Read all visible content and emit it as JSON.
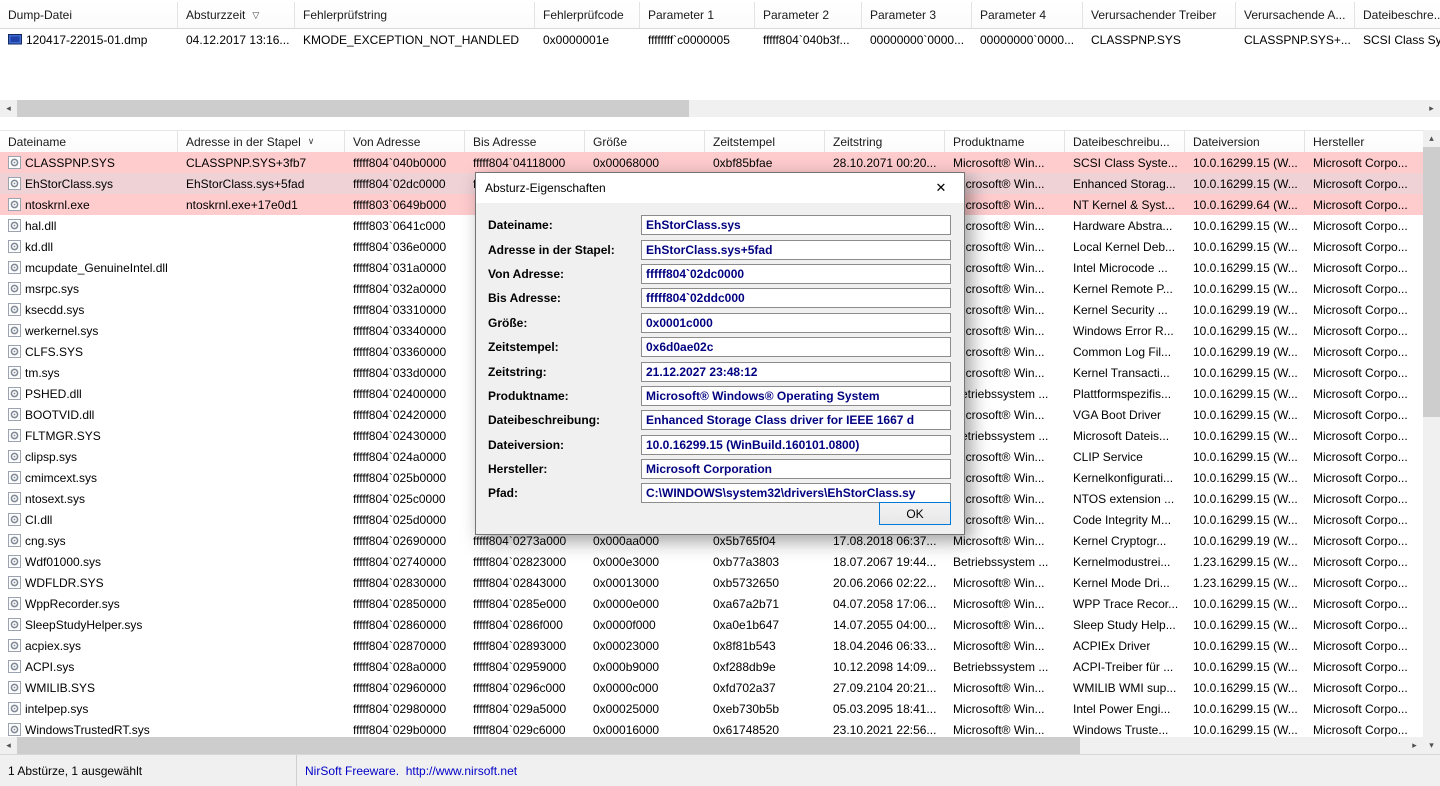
{
  "icons": {
    "close": "✕",
    "scroll_left": "◂",
    "scroll_right": "▸",
    "scroll_up": "▴",
    "scroll_down": "▾",
    "sort_upper": "▽",
    "sort_lower": "∨",
    "dump_file": "dump-file-icon",
    "driver_file": "driver-file-icon"
  },
  "colors": {
    "row_highlight": "#ffccce",
    "row_selected": "#eed2d6",
    "dialog_value": "#000080",
    "link": "#0000c8",
    "accent_button_border": "#0078d7"
  },
  "upper_table": {
    "columns": [
      {
        "label": "Dump-Datei"
      },
      {
        "label": "Absturzzeit",
        "sort": "▽"
      },
      {
        "label": "Fehlerprüfstring"
      },
      {
        "label": "Fehlerprüfcode"
      },
      {
        "label": "Parameter 1"
      },
      {
        "label": "Parameter 2"
      },
      {
        "label": "Parameter 3"
      },
      {
        "label": "Parameter 4"
      },
      {
        "label": "Verursachender Treiber"
      },
      {
        "label": "Verursachende A..."
      },
      {
        "label": "Dateibeschre..."
      }
    ],
    "rows": [
      {
        "cells": [
          "120417-22015-01.dmp",
          "04.12.2017 13:16...",
          "KMODE_EXCEPTION_NOT_HANDLED",
          "0x0000001e",
          "ffffffff`c0000005",
          "fffff804`040b3f...",
          "00000000`0000...",
          "00000000`0000...",
          "CLASSPNP.SYS",
          "CLASSPNP.SYS+...",
          "SCSI Class Sy..."
        ]
      }
    ]
  },
  "lower_table": {
    "columns": [
      {
        "label": "Dateiname"
      },
      {
        "label": "Adresse in der Stapel",
        "sort": "∨"
      },
      {
        "label": "Von Adresse"
      },
      {
        "label": "Bis Adresse"
      },
      {
        "label": "Größe"
      },
      {
        "label": "Zeitstempel"
      },
      {
        "label": "Zeitstring"
      },
      {
        "label": "Produktname"
      },
      {
        "label": "Dateibeschreibu..."
      },
      {
        "label": "Dateiversion"
      },
      {
        "label": "Hersteller"
      }
    ],
    "rows": [
      {
        "highlighted": true,
        "selected": false,
        "cells": [
          "CLASSPNP.SYS",
          "CLASSPNP.SYS+3fb7",
          "fffff804`040b0000",
          "fffff804`04118000",
          "0x00068000",
          "0xbf85bfae",
          "28.10.2071 00:20...",
          "Microsoft® Win...",
          "SCSI Class Syste...",
          "10.0.16299.15 (W...",
          "Microsoft Corpo..."
        ]
      },
      {
        "highlighted": true,
        "selected": true,
        "cells": [
          "EhStorClass.sys",
          "EhStorClass.sys+5fad",
          "fffff804`02dc0000",
          "fffff804`02ddc000",
          "0x0001c000",
          "0x6d0ae02c",
          "21.12.2027 23:48...",
          "Microsoft® Win...",
          "Enhanced Storag...",
          "10.0.16299.15 (W...",
          "Microsoft Corpo..."
        ]
      },
      {
        "highlighted": true,
        "selected": false,
        "cells": [
          "ntoskrnl.exe",
          "ntoskrnl.exe+17e0d1",
          "fffff803`0649b000",
          "",
          "",
          "",
          "",
          "Microsoft® Win...",
          "NT Kernel & Syst...",
          "10.0.16299.64 (W...",
          "Microsoft Corpo..."
        ]
      },
      {
        "highlighted": false,
        "selected": false,
        "cells": [
          "hal.dll",
          "",
          "fffff803`0641c000",
          "",
          "",
          "",
          "",
          "Microsoft® Win...",
          "Hardware Abstra...",
          "10.0.16299.15 (W...",
          "Microsoft Corpo..."
        ]
      },
      {
        "highlighted": false,
        "selected": false,
        "cells": [
          "kd.dll",
          "",
          "fffff804`036e0000",
          "",
          "",
          "",
          "",
          "Microsoft® Win...",
          "Local Kernel Deb...",
          "10.0.16299.15 (W...",
          "Microsoft Corpo..."
        ]
      },
      {
        "highlighted": false,
        "selected": false,
        "cells": [
          "mcupdate_GenuineIntel.dll",
          "",
          "fffff804`031a0000",
          "",
          "",
          "",
          "",
          "Microsoft® Win...",
          "Intel Microcode ...",
          "10.0.16299.15 (W...",
          "Microsoft Corpo..."
        ]
      },
      {
        "highlighted": false,
        "selected": false,
        "cells": [
          "msrpc.sys",
          "",
          "fffff804`032a0000",
          "",
          "",
          "",
          "",
          "Microsoft® Win...",
          "Kernel Remote P...",
          "10.0.16299.15 (W...",
          "Microsoft Corpo..."
        ]
      },
      {
        "highlighted": false,
        "selected": false,
        "cells": [
          "ksecdd.sys",
          "",
          "fffff804`03310000",
          "",
          "",
          "",
          "",
          "Microsoft® Win...",
          "Kernel Security ...",
          "10.0.16299.19 (W...",
          "Microsoft Corpo..."
        ]
      },
      {
        "highlighted": false,
        "selected": false,
        "cells": [
          "werkernel.sys",
          "",
          "fffff804`03340000",
          "",
          "",
          "",
          "",
          "Microsoft® Win...",
          "Windows Error R...",
          "10.0.16299.15 (W...",
          "Microsoft Corpo..."
        ]
      },
      {
        "highlighted": false,
        "selected": false,
        "cells": [
          "CLFS.SYS",
          "",
          "fffff804`03360000",
          "",
          "",
          "",
          "",
          "Microsoft® Win...",
          "Common Log Fil...",
          "10.0.16299.19 (W...",
          "Microsoft Corpo..."
        ]
      },
      {
        "highlighted": false,
        "selected": false,
        "cells": [
          "tm.sys",
          "",
          "fffff804`033d0000",
          "",
          "",
          "",
          "",
          "Microsoft® Win...",
          "Kernel Transacti...",
          "10.0.16299.15 (W...",
          "Microsoft Corpo..."
        ]
      },
      {
        "highlighted": false,
        "selected": false,
        "cells": [
          "PSHED.dll",
          "",
          "fffff804`02400000",
          "",
          "",
          "",
          "",
          "Betriebssystem ...",
          "Plattformspezifis...",
          "10.0.16299.15 (W...",
          "Microsoft Corpo..."
        ]
      },
      {
        "highlighted": false,
        "selected": false,
        "cells": [
          "BOOTVID.dll",
          "",
          "fffff804`02420000",
          "",
          "",
          "",
          "",
          "Microsoft® Win...",
          "VGA Boot Driver",
          "10.0.16299.15 (W...",
          "Microsoft Corpo..."
        ]
      },
      {
        "highlighted": false,
        "selected": false,
        "cells": [
          "FLTMGR.SYS",
          "",
          "fffff804`02430000",
          "",
          "",
          "",
          "",
          "Betriebssystem ...",
          "Microsoft Dateis...",
          "10.0.16299.15 (W...",
          "Microsoft Corpo..."
        ]
      },
      {
        "highlighted": false,
        "selected": false,
        "cells": [
          "clipsp.sys",
          "",
          "fffff804`024a0000",
          "",
          "",
          "",
          "",
          "Microsoft® Win...",
          "CLIP Service",
          "10.0.16299.15 (W...",
          "Microsoft Corpo..."
        ]
      },
      {
        "highlighted": false,
        "selected": false,
        "cells": [
          "cmimcext.sys",
          "",
          "fffff804`025b0000",
          "",
          "",
          "",
          "",
          "Microsoft® Win...",
          "Kernelkonfigurati...",
          "10.0.16299.15 (W...",
          "Microsoft Corpo..."
        ]
      },
      {
        "highlighted": false,
        "selected": false,
        "cells": [
          "ntosext.sys",
          "",
          "fffff804`025c0000",
          "",
          "",
          "",
          "",
          "Microsoft® Win...",
          "NTOS extension ...",
          "10.0.16299.15 (W...",
          "Microsoft Corpo..."
        ]
      },
      {
        "highlighted": false,
        "selected": false,
        "cells": [
          "CI.dll",
          "",
          "fffff804`025d0000",
          "",
          "",
          "",
          "",
          "Microsoft® Win...",
          "Code Integrity M...",
          "10.0.16299.15 (W...",
          "Microsoft Corpo..."
        ]
      },
      {
        "highlighted": false,
        "selected": false,
        "cells": [
          "cng.sys",
          "",
          "fffff804`02690000",
          "fffff804`0273a000",
          "0x000aa000",
          "0x5b765f04",
          "17.08.2018 06:37...",
          "Microsoft® Win...",
          "Kernel Cryptogr...",
          "10.0.16299.19 (W...",
          "Microsoft Corpo..."
        ]
      },
      {
        "highlighted": false,
        "selected": false,
        "cells": [
          "Wdf01000.sys",
          "",
          "fffff804`02740000",
          "fffff804`02823000",
          "0x000e3000",
          "0xb77a3803",
          "18.07.2067 19:44...",
          "Betriebssystem ...",
          "Kernelmodustrei...",
          "1.23.16299.15 (W...",
          "Microsoft Corpo..."
        ]
      },
      {
        "highlighted": false,
        "selected": false,
        "cells": [
          "WDFLDR.SYS",
          "",
          "fffff804`02830000",
          "fffff804`02843000",
          "0x00013000",
          "0xb5732650",
          "20.06.2066 02:22...",
          "Microsoft® Win...",
          "Kernel Mode Dri...",
          "1.23.16299.15 (W...",
          "Microsoft Corpo..."
        ]
      },
      {
        "highlighted": false,
        "selected": false,
        "cells": [
          "WppRecorder.sys",
          "",
          "fffff804`02850000",
          "fffff804`0285e000",
          "0x0000e000",
          "0xa67a2b71",
          "04.07.2058 17:06...",
          "Microsoft® Win...",
          "WPP Trace Recor...",
          "10.0.16299.15 (W...",
          "Microsoft Corpo..."
        ]
      },
      {
        "highlighted": false,
        "selected": false,
        "cells": [
          "SleepStudyHelper.sys",
          "",
          "fffff804`02860000",
          "fffff804`0286f000",
          "0x0000f000",
          "0xa0e1b647",
          "14.07.2055 04:00...",
          "Microsoft® Win...",
          "Sleep Study Help...",
          "10.0.16299.15 (W...",
          "Microsoft Corpo..."
        ]
      },
      {
        "highlighted": false,
        "selected": false,
        "cells": [
          "acpiex.sys",
          "",
          "fffff804`02870000",
          "fffff804`02893000",
          "0x00023000",
          "0x8f81b543",
          "18.04.2046 06:33...",
          "Microsoft® Win...",
          "ACPIEx Driver",
          "10.0.16299.15 (W...",
          "Microsoft Corpo..."
        ]
      },
      {
        "highlighted": false,
        "selected": false,
        "cells": [
          "ACPI.sys",
          "",
          "fffff804`028a0000",
          "fffff804`02959000",
          "0x000b9000",
          "0xf288db9e",
          "10.12.2098 14:09...",
          "Betriebssystem ...",
          "ACPI-Treiber für ...",
          "10.0.16299.15 (W...",
          "Microsoft Corpo..."
        ]
      },
      {
        "highlighted": false,
        "selected": false,
        "cells": [
          "WMILIB.SYS",
          "",
          "fffff804`02960000",
          "fffff804`0296c000",
          "0x0000c000",
          "0xfd702a37",
          "27.09.2104 20:21...",
          "Microsoft® Win...",
          "WMILIB WMI sup...",
          "10.0.16299.15 (W...",
          "Microsoft Corpo..."
        ]
      },
      {
        "highlighted": false,
        "selected": false,
        "cells": [
          "intelpep.sys",
          "",
          "fffff804`02980000",
          "fffff804`029a5000",
          "0x00025000",
          "0xeb730b5b",
          "05.03.2095 18:41...",
          "Microsoft® Win...",
          "Intel Power Engi...",
          "10.0.16299.15 (W...",
          "Microsoft Corpo..."
        ]
      },
      {
        "highlighted": false,
        "selected": false,
        "cells": [
          "WindowsTrustedRT.sys",
          "",
          "fffff804`029b0000",
          "fffff804`029c6000",
          "0x00016000",
          "0x61748520",
          "23.10.2021 22:56...",
          "Microsoft® Win...",
          "Windows Truste...",
          "10.0.16299.15 (W...",
          "Microsoft Corpo..."
        ]
      }
    ]
  },
  "dialog": {
    "title": "Absturz-Eigenschaften",
    "ok_label": "OK",
    "fields": [
      {
        "label": "Dateiname:",
        "value": "EhStorClass.sys"
      },
      {
        "label": "Adresse in der Stapel:",
        "value": "EhStorClass.sys+5fad"
      },
      {
        "label": "Von Adresse:",
        "value": "fffff804`02dc0000"
      },
      {
        "label": "Bis Adresse:",
        "value": "fffff804`02ddc000"
      },
      {
        "label": "Größe:",
        "value": "0x0001c000"
      },
      {
        "label": "Zeitstempel:",
        "value": "0x6d0ae02c"
      },
      {
        "label": "Zeitstring:",
        "value": "21.12.2027 23:48:12"
      },
      {
        "label": "Produktname:",
        "value": "Microsoft® Windows® Operating System"
      },
      {
        "label": "Dateibeschreibung:",
        "value": "Enhanced Storage Class driver for IEEE 1667 d"
      },
      {
        "label": "Dateiversion:",
        "value": "10.0.16299.15 (WinBuild.160101.0800)"
      },
      {
        "label": "Hersteller:",
        "value": "Microsoft Corporation"
      },
      {
        "label": "Pfad:",
        "value": "C:\\WINDOWS\\system32\\drivers\\EhStorClass.sy"
      }
    ]
  },
  "statusbar": {
    "left": "1 Abstürze, 1 ausgewählt",
    "right": "NirSoft Freeware.  http://www.nirsoft.net"
  }
}
